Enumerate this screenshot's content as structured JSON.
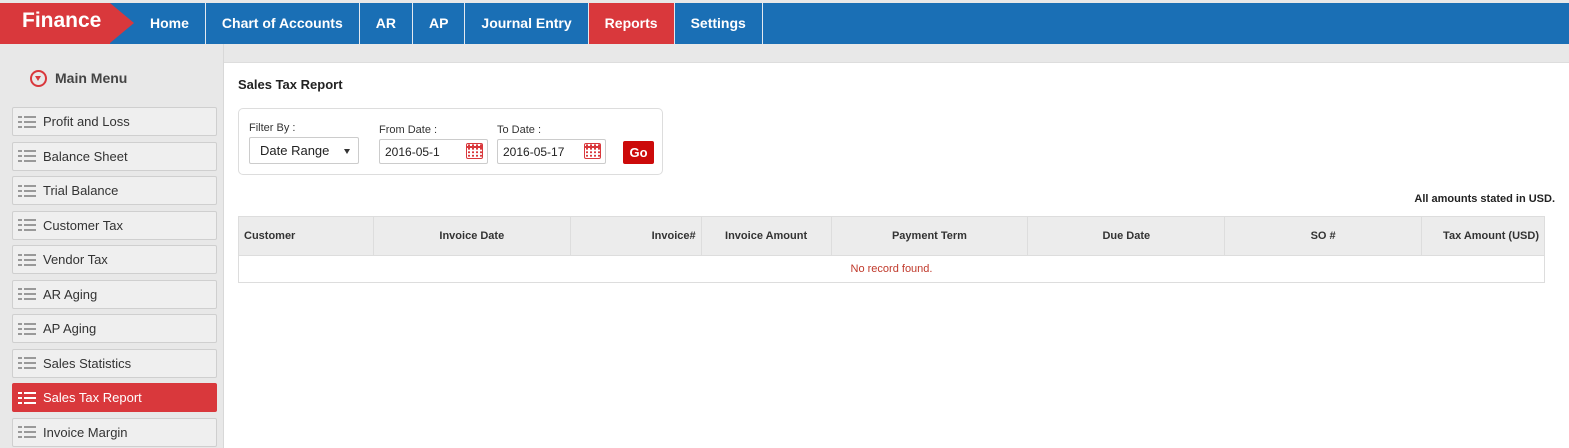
{
  "app": {
    "brand": "Finance"
  },
  "nav": [
    {
      "label": "Home",
      "active": false
    },
    {
      "label": "Chart of Accounts",
      "active": false
    },
    {
      "label": "AR",
      "active": false
    },
    {
      "label": "AP",
      "active": false
    },
    {
      "label": "Journal Entry",
      "active": false
    },
    {
      "label": "Reports",
      "active": true
    },
    {
      "label": "Settings",
      "active": false
    }
  ],
  "sidebar": {
    "title": "Main Menu",
    "items": [
      {
        "label": "Profit and Loss",
        "active": false
      },
      {
        "label": "Balance Sheet",
        "active": false
      },
      {
        "label": "Trial Balance",
        "active": false
      },
      {
        "label": "Customer Tax",
        "active": false
      },
      {
        "label": "Vendor Tax",
        "active": false
      },
      {
        "label": "AR Aging",
        "active": false
      },
      {
        "label": "AP Aging",
        "active": false
      },
      {
        "label": "Sales Statistics",
        "active": false
      },
      {
        "label": "Sales Tax Report",
        "active": true
      },
      {
        "label": "Invoice Margin",
        "active": false
      }
    ]
  },
  "report": {
    "title": "Sales Tax Report",
    "filter": {
      "filter_by_label": "Filter By :",
      "filter_by_value": "Date Range",
      "from_label": "From Date :",
      "from_value": "2016-05-1",
      "to_label": "To Date :",
      "to_value": "2016-05-17",
      "go_label": "Go"
    },
    "amounts_note": "All amounts stated in USD.",
    "columns": [
      "Customer",
      "Invoice Date",
      "Invoice#",
      "Invoice Amount",
      "Payment Term",
      "Due Date",
      "SO #",
      "Tax Amount (USD)"
    ],
    "empty_message": "No record found."
  },
  "colors": {
    "brand": "#d9383c",
    "nav_bg": "#1a6fb5",
    "go_button": "#cc0a0a"
  },
  "icons": {
    "menu_toggle": "chevron-down-circle-icon",
    "menu_item": "list-icon",
    "date_picker": "calendar-icon",
    "select": "caret-down-icon"
  }
}
